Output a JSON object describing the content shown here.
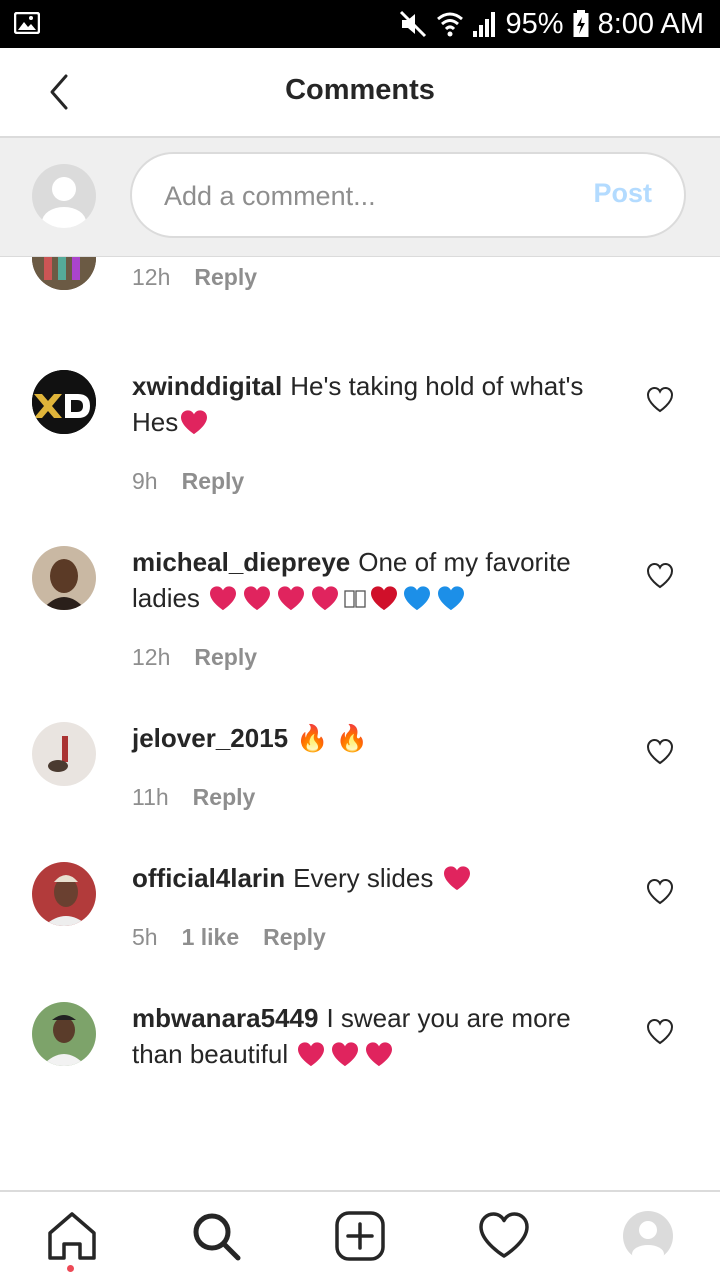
{
  "status_bar": {
    "battery": "95%",
    "time": "8:00 AM",
    "icons": [
      "image-icon",
      "mute-icon",
      "wifi-icon",
      "signal-icon",
      "battery-icon"
    ]
  },
  "header": {
    "title": "Comments",
    "back_icon": "chevron-left-icon"
  },
  "composer": {
    "placeholder": "Add a comment...",
    "post_label": "Post"
  },
  "comments": [
    {
      "username": "",
      "text": "",
      "time": "12h",
      "reply": "Reply"
    },
    {
      "username": "xwinddigital",
      "text": "He's taking hold of what's Hes",
      "time": "9h",
      "reply": "Reply"
    },
    {
      "username": "micheal_diepreye",
      "text": "One of my favorite ladies",
      "time": "12h",
      "reply": "Reply"
    },
    {
      "username": "jelover_2015",
      "text": "🔥 🔥",
      "time": "11h",
      "reply": "Reply"
    },
    {
      "username": "official4larin",
      "text": "Every slides",
      "time": "5h",
      "likes": "1 like",
      "reply": "Reply"
    },
    {
      "username": "mbwanara5449",
      "text": "I swear you are more than beautiful",
      "reply": ""
    }
  ],
  "tab_bar": [
    "home-icon",
    "search-icon",
    "add-post-icon",
    "activity-heart-icon",
    "profile-icon"
  ],
  "colors": {
    "accent_disabled": "#b3dbff",
    "heart_red": "#e0245e",
    "notification_dot": "#ed4956"
  }
}
